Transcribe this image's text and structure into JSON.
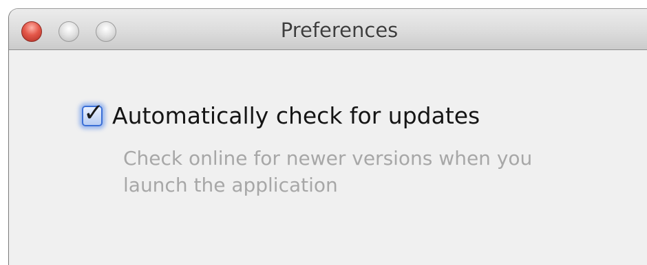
{
  "window": {
    "title": "Preferences",
    "controls": {
      "close": "close-button",
      "minimize": "minimize-button",
      "zoom": "zoom-button"
    }
  },
  "preferences": {
    "auto_update": {
      "label": "Automatically check for updates",
      "checked": true,
      "description": "Check online for newer versions when you launch the application"
    }
  },
  "colors": {
    "close_button": "#e4584a",
    "checkbox_accent": "#3a6fd6",
    "description_text": "#a7a7a7"
  }
}
